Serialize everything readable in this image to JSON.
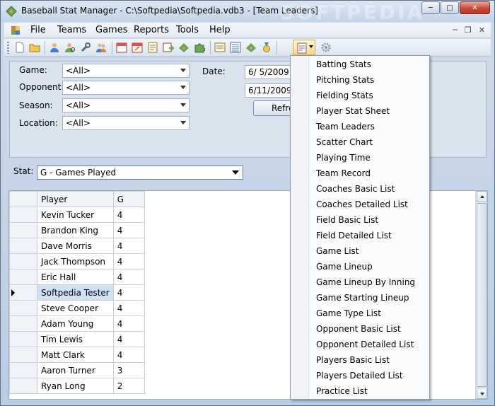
{
  "window": {
    "title": "Baseball Stat Manager - C:\\Softpedia\\Softpedia.vdb3 - [Team Leaders]",
    "watermark": "SOFTPEDIA"
  },
  "menubar": {
    "items": [
      {
        "label": "File"
      },
      {
        "label": "Teams"
      },
      {
        "label": "Games"
      },
      {
        "label": "Reports"
      },
      {
        "label": "Tools"
      },
      {
        "label": "Help"
      }
    ]
  },
  "filters": {
    "game_label": "Game:",
    "game_value": "<All>",
    "opponent_label": "Opponent:",
    "opponent_value": "<All>",
    "season_label": "Season:",
    "season_value": "<All>",
    "location_label": "Location:",
    "location_value": "<All>",
    "date_label": "Date:",
    "date_from": "6/ 5/2009",
    "date_to": "6/11/2009",
    "refresh_label": "Refresh"
  },
  "stat": {
    "label": "Stat:",
    "value": "G - Games Played"
  },
  "grid": {
    "columns": [
      "Player",
      "G"
    ],
    "rows": [
      {
        "player": "Kevin Tucker",
        "g": "4"
      },
      {
        "player": "Brandon King",
        "g": "4"
      },
      {
        "player": "Dave Morris",
        "g": "4"
      },
      {
        "player": "Jack Thompson",
        "g": "4"
      },
      {
        "player": "Eric Hall",
        "g": "4"
      },
      {
        "player": "Softpedia Tester",
        "g": "4"
      },
      {
        "player": "Steve Cooper",
        "g": "4"
      },
      {
        "player": "Adam Young",
        "g": "4"
      },
      {
        "player": "Tim Lewis",
        "g": "4"
      },
      {
        "player": "Matt Clark",
        "g": "4"
      },
      {
        "player": "Aaron Turner",
        "g": "3"
      },
      {
        "player": "Ryan Long",
        "g": "2"
      }
    ],
    "selected_row": "Softpedia Tester"
  },
  "reports_dropdown": {
    "items": [
      "Batting Stats",
      "Pitching Stats",
      "Fielding Stats",
      "Player Stat Sheet",
      "Team Leaders",
      "Scatter Chart",
      "Playing Time",
      "Team Record",
      "Coaches Basic List",
      "Coaches Detailed List",
      "Field Basic List",
      "Field Detailed List",
      "Game List",
      "Game Lineup",
      "Game Lineup By Inning",
      "Game Starting Lineup",
      "Game Type List",
      "Opponent Basic List",
      "Opponent Detailed List",
      "Players Basic List",
      "Players Detailed List",
      "Practice List"
    ]
  },
  "toolbar_icons": [
    "new-icon",
    "open-icon",
    "player-icon",
    "player-search-icon",
    "wrench-icon",
    "players-icon",
    "calendar-icon",
    "calendar-edit-icon",
    "notepad-icon",
    "calendar-export-icon",
    "field-icon",
    "puzzle-icon",
    "note-icon",
    "list-icon",
    "baseball-field-icon",
    "medal-icon",
    "report-icon",
    "settings-gear-icon"
  ],
  "colors": {
    "chrome": "#c3d4e8",
    "selected_row": "#cfe1f6",
    "close_button": "#c74a38",
    "menu_highlight": "#ffd98a"
  }
}
